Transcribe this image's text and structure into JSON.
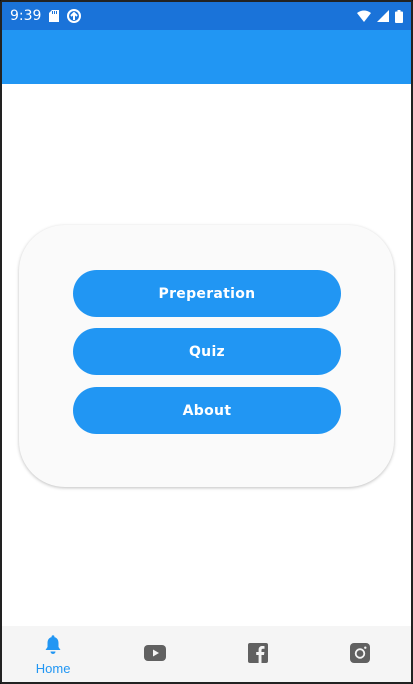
{
  "status_bar": {
    "time": "9:39"
  },
  "menu": {
    "buttons": [
      {
        "label": "Preperation"
      },
      {
        "label": "Quiz"
      },
      {
        "label": "About"
      }
    ]
  },
  "bottom_nav": {
    "items": [
      {
        "label": "Home",
        "icon": "bell-icon",
        "active": true
      },
      {
        "label": "",
        "icon": "youtube-icon",
        "active": false
      },
      {
        "label": "",
        "icon": "facebook-icon",
        "active": false
      },
      {
        "label": "",
        "icon": "instagram-icon",
        "active": false
      }
    ]
  },
  "colors": {
    "primary": "#2196f3",
    "status_bar": "#1a73d9",
    "inactive_icon": "#616161"
  }
}
